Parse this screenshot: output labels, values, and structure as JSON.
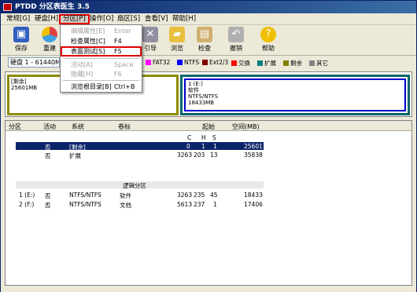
{
  "window": {
    "title": "PTDD 分区表医生 3.5"
  },
  "menubar": [
    {
      "name": "menu-general",
      "label": "常规[G]"
    },
    {
      "name": "menu-disk",
      "label": "硬盘[H]"
    },
    {
      "name": "menu-partition",
      "label": "分区[P]"
    },
    {
      "name": "menu-operation",
      "label": "操作[O]"
    },
    {
      "name": "menu-sector",
      "label": "扇区[S]"
    },
    {
      "name": "menu-view",
      "label": "查看[V]"
    },
    {
      "name": "menu-help",
      "label": "帮助[H]"
    }
  ],
  "toolbar": {
    "save": "保存",
    "rebuild": "重建",
    "guide": "引导",
    "browse": "浏览",
    "check": "检查",
    "undo": "撤销",
    "help": "帮助"
  },
  "disk_select": {
    "value": "硬盘 1 - 61440M"
  },
  "legend": [
    {
      "label": "FAT32",
      "color": "#ff00ff"
    },
    {
      "label": "NTFS",
      "color": "#0000ff"
    },
    {
      "label": "Ext2/3",
      "color": "#800000"
    },
    {
      "label": "交换",
      "color": "#ff0000"
    },
    {
      "label": "扩展",
      "color": "#008080"
    },
    {
      "label": "剩余",
      "color": "#808000"
    },
    {
      "label": "其它",
      "color": "#808080"
    }
  ],
  "map": {
    "p1": {
      "line1": "[剩余]",
      "line2": "25601MB"
    },
    "p2": {
      "line1": "1 (E:)",
      "line2": "软件",
      "line3": "NTFS/NTFS",
      "line4": "18433MB"
    }
  },
  "dropdown": [
    {
      "label": "编辑属性[E]",
      "key": "Enter",
      "disabled": true
    },
    {
      "label": "检查属性[C]",
      "key": "F4",
      "disabled": false
    },
    {
      "label": "表面测试[S]",
      "key": "F5",
      "disabled": false,
      "highlight": true
    },
    {
      "label": "活动[A]",
      "key": "Space",
      "disabled": true
    },
    {
      "label": "隐藏[H]",
      "key": "F6",
      "disabled": true
    },
    {
      "label": "浏览根目录[B]",
      "key": "Ctrl+B",
      "disabled": false
    }
  ],
  "table": {
    "headers": {
      "partition": "分区",
      "active": "活动",
      "system": "系统",
      "label": "卷标",
      "start": "起始",
      "size": "空间(MB)"
    },
    "subheaders": {
      "c": "C",
      "h": "H",
      "s": "S"
    },
    "primary_rows": [
      {
        "part": "",
        "active": "否",
        "system": "[剩余]",
        "label": "",
        "c": "0",
        "h": "1",
        "s": "1",
        "size": "25601"
      },
      {
        "part": "",
        "active": "否",
        "system": "扩展",
        "label": "",
        "c": "3263",
        "h": "203",
        "s": "13",
        "size": "35838"
      }
    ],
    "logical_header": "逻辑分区",
    "logical_rows": [
      {
        "part": "1 (E:)",
        "active": "否",
        "system": "NTFS/NTFS",
        "label": "软件",
        "c": "3263",
        "h": "235",
        "s": "45",
        "size": "18433"
      },
      {
        "part": "2 (F:)",
        "active": "否",
        "system": "NTFS/NTFS",
        "label": "文档",
        "c": "5613",
        "h": "237",
        "s": "1",
        "size": "17406"
      }
    ]
  }
}
